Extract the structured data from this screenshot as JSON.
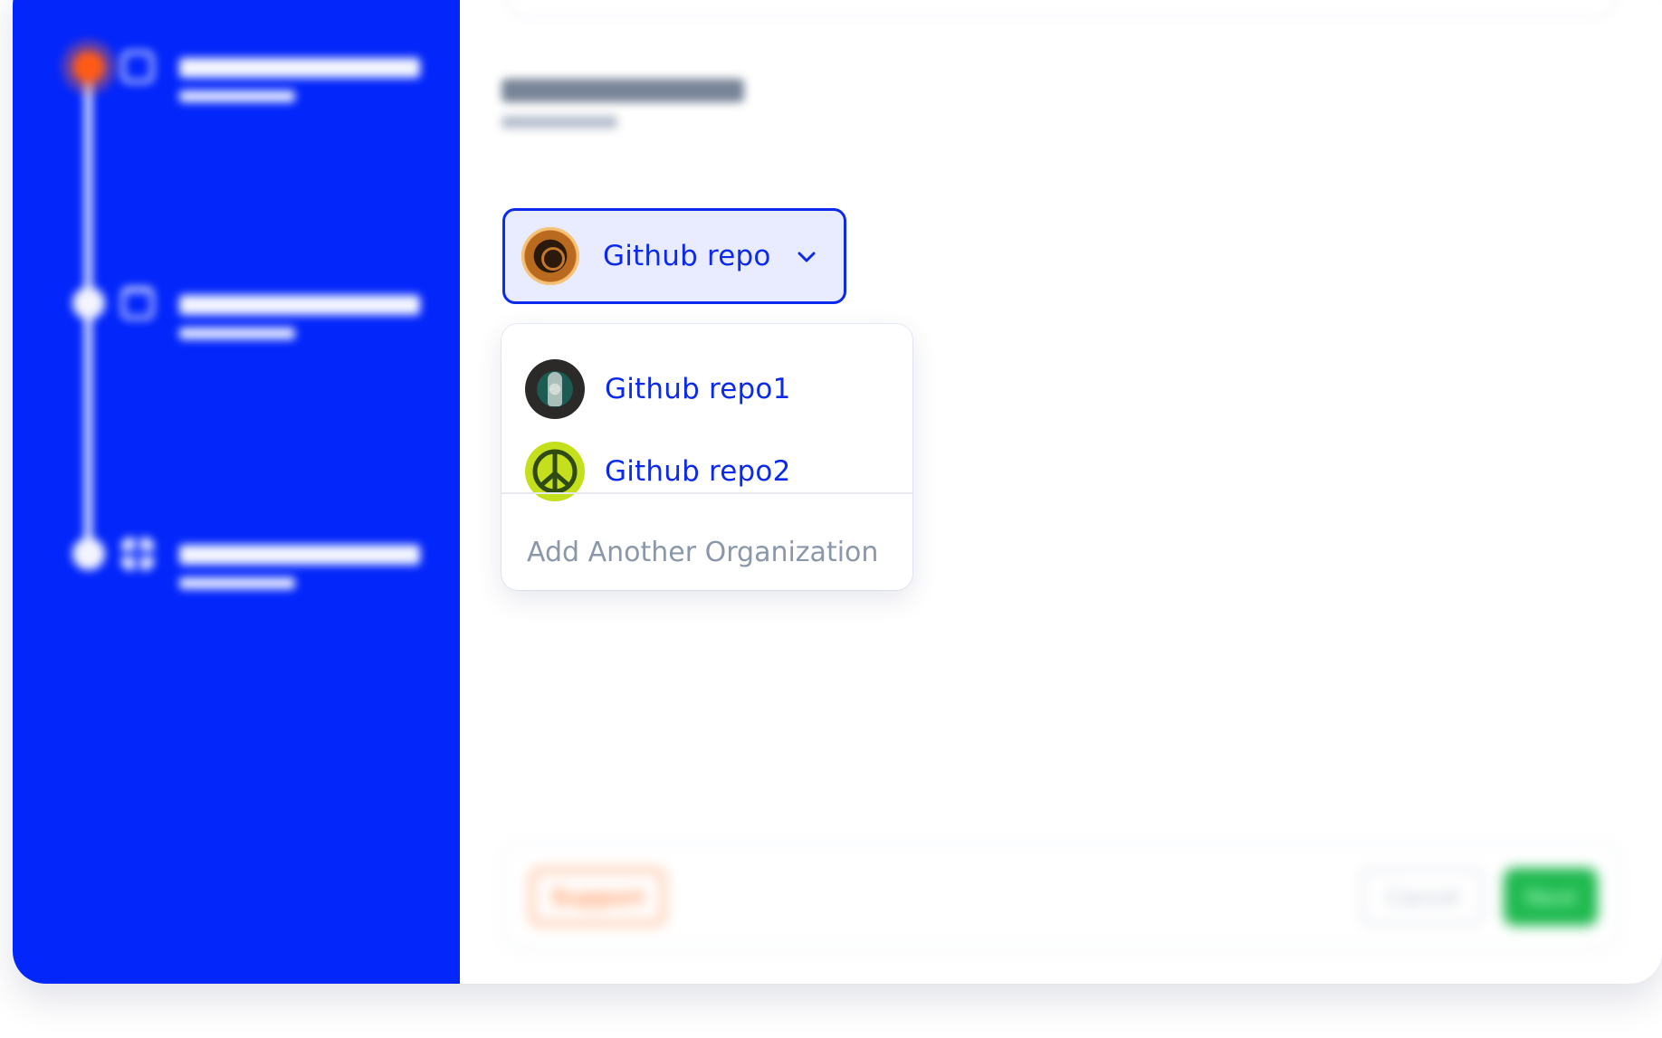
{
  "selector": {
    "selected_label": "Github repo",
    "icon": "chevron-down-icon"
  },
  "dropdown": {
    "items": [
      {
        "label": "Github repo1",
        "avatar": "starbucks-style-logo"
      },
      {
        "label": "Github repo2",
        "avatar": "peace-sign-logo"
      }
    ],
    "add_label": "Add Another Organization"
  },
  "footer": {
    "support_label": "Support",
    "cancel_label": "Cancel",
    "next_label": "Next"
  },
  "colors": {
    "sidebar": "#0326fa",
    "accent_blue": "#0c2aee",
    "active_step": "#ff5b16",
    "next_green": "#1fb94f",
    "muted_text": "#8b97aa"
  }
}
